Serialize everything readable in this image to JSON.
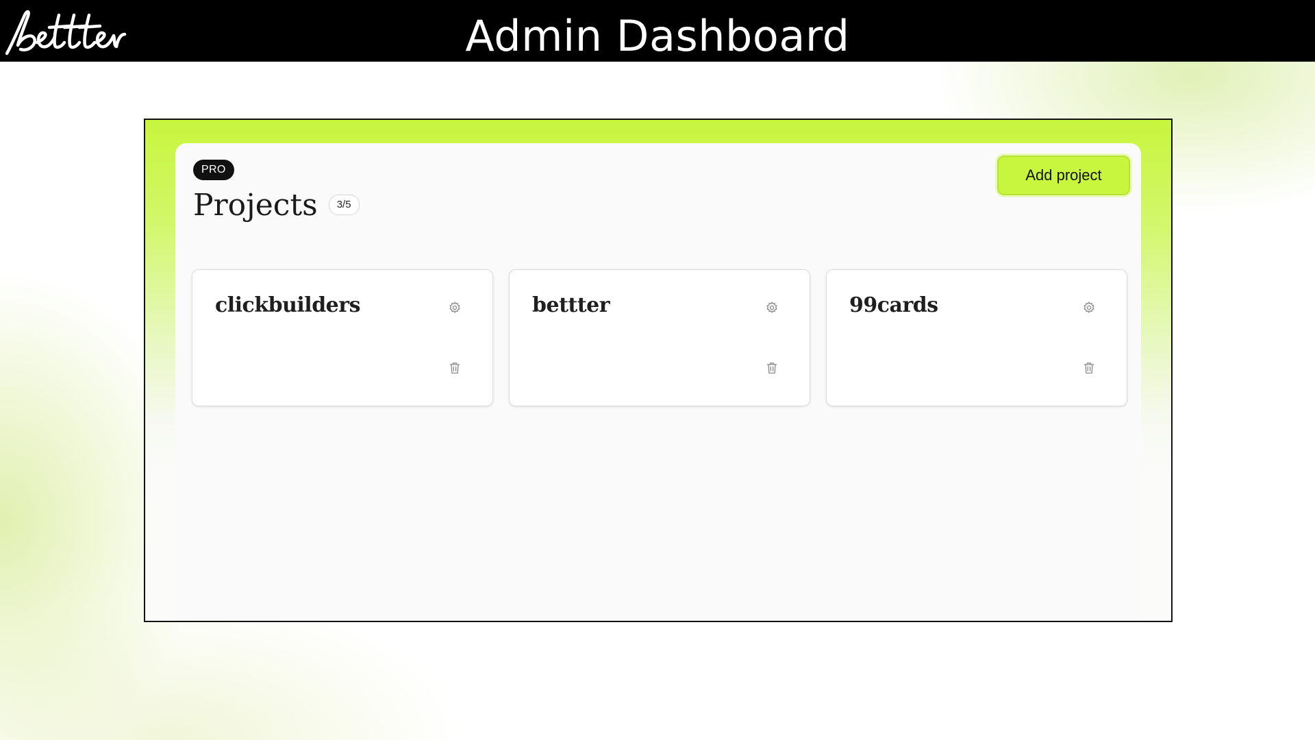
{
  "header": {
    "logo_text": "bettter",
    "title": "Admin Dashboard"
  },
  "colors": {
    "accent": "#c8f53d",
    "header_bg": "#000000"
  },
  "dashboard": {
    "plan_badge": "PRO",
    "heading": "Projects",
    "project_count": "3/5",
    "add_button_label": "Add project",
    "projects": [
      {
        "name": "clickbuilders",
        "icons": [
          "gear-icon",
          "trash-icon"
        ]
      },
      {
        "name": "bettter",
        "icons": [
          "gear-icon",
          "trash-icon"
        ]
      },
      {
        "name": "99cards",
        "icons": [
          "gear-icon",
          "trash-icon"
        ]
      }
    ]
  }
}
